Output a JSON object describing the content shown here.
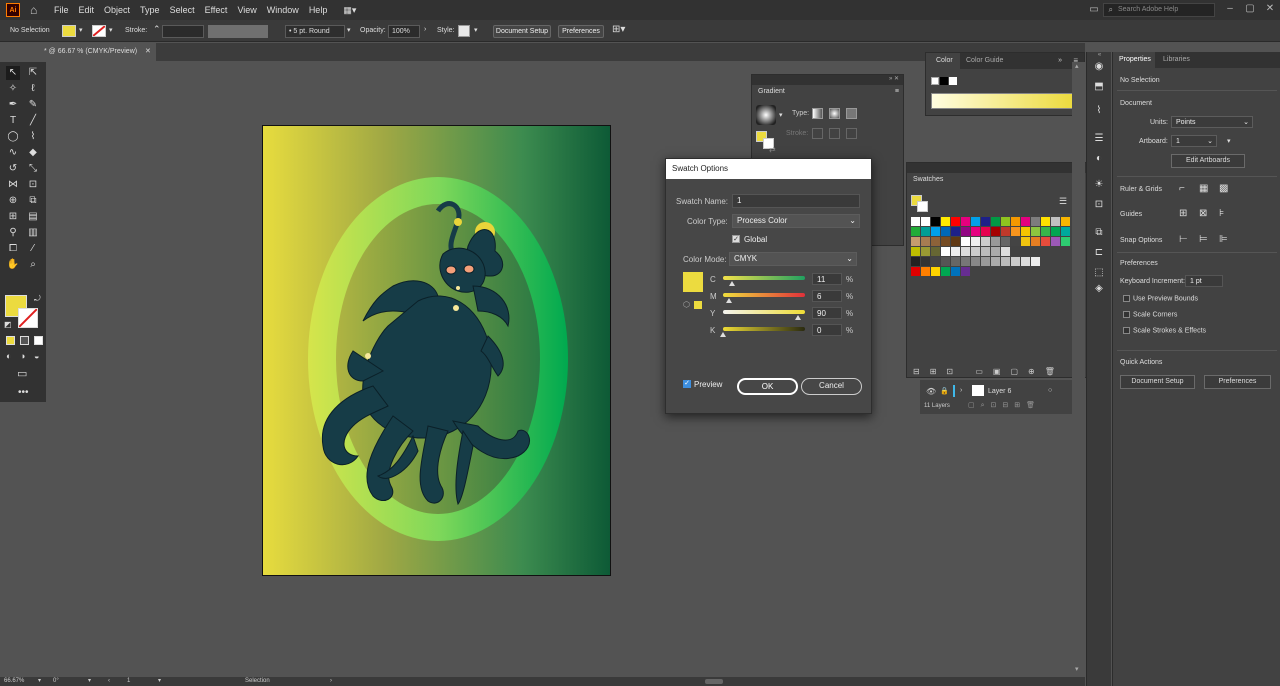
{
  "app": {
    "logo": "Ai",
    "home_icon": "home-icon"
  },
  "menu": [
    "File",
    "Edit",
    "Object",
    "Type",
    "Select",
    "Effect",
    "View",
    "Window",
    "Help"
  ],
  "search": {
    "placeholder": "Search Adobe Help"
  },
  "control": {
    "selection": "No Selection",
    "stroke_label": "Stroke:",
    "brush": "5 pt. Round",
    "opacity_label": "Opacity:",
    "opacity_value": "100%",
    "style_label": "Style:",
    "doc_setup": "Document Setup",
    "preferences": "Preferences"
  },
  "doc_tab": "* @ 66.67 % (CMYK/Preview)",
  "gradient_panel": {
    "title": "Gradient",
    "type_label": "Type:",
    "stroke_label": "Stroke:"
  },
  "color_panel": {
    "tabs": [
      "Color",
      "Color Guide"
    ]
  },
  "swatches_panel": {
    "title": "Swatches"
  },
  "layers": {
    "layer_name": "Layer 6",
    "count": "11 Layers"
  },
  "dialog": {
    "title": "Swatch Options",
    "swatch_name_label": "Swatch Name:",
    "swatch_name": "1",
    "color_type_label": "Color Type:",
    "color_type": "Process Color",
    "global_label": "Global",
    "color_mode_label": "Color Mode:",
    "color_mode": "CMYK",
    "channels": [
      {
        "label": "C",
        "value": "11"
      },
      {
        "label": "M",
        "value": "6"
      },
      {
        "label": "Y",
        "value": "90"
      },
      {
        "label": "K",
        "value": "0"
      }
    ],
    "percent": "%",
    "preview_label": "Preview",
    "ok": "OK",
    "cancel": "Cancel",
    "swatch_color": "#ecdb3f"
  },
  "properties": {
    "tabs": [
      "Properties",
      "Libraries"
    ],
    "no_selection": "No Selection",
    "document_heading": "Document",
    "units_label": "Units:",
    "units_value": "Points",
    "artboard_label": "Artboard:",
    "artboard_value": "1",
    "edit_artboards": "Edit Artboards",
    "ruler_grids": "Ruler & Grids",
    "guides": "Guides",
    "snap_options": "Snap Options",
    "preferences_heading": "Preferences",
    "keyboard_inc_label": "Keyboard Increment:",
    "keyboard_inc_value": "1 pt",
    "use_preview_bounds": "Use Preview Bounds",
    "scale_corners": "Scale Corners",
    "scale_strokes": "Scale Strokes & Effects",
    "quick_actions": "Quick Actions",
    "qa_doc_setup": "Document Setup",
    "qa_preferences": "Preferences"
  },
  "status": {
    "zoom": "66.67%",
    "rotation": "0°",
    "artboard": "1",
    "tool": "Selection"
  }
}
